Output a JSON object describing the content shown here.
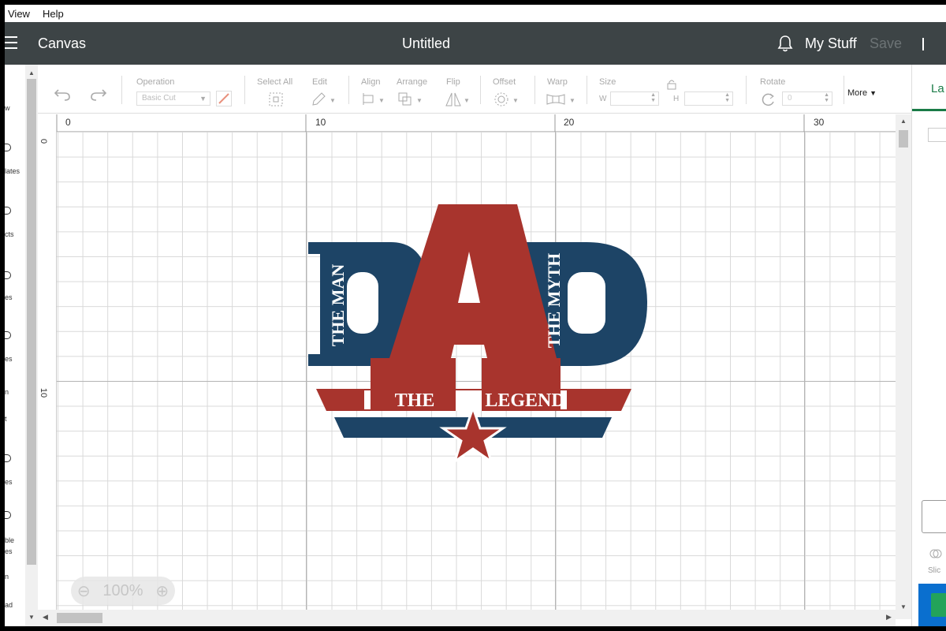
{
  "menu": {
    "items": [
      "View",
      "Help"
    ]
  },
  "header": {
    "app_title": "Canvas",
    "doc_title": "Untitled",
    "my_stuff": "My Stuff",
    "save": "Save"
  },
  "left_nav": {
    "fragments": [
      "w",
      "lates",
      "cts",
      "es",
      "es",
      "n",
      "t",
      "es",
      "ble",
      "es",
      "n",
      "ad"
    ]
  },
  "toolbar": {
    "operation_label": "Operation",
    "operation_value": "Basic Cut",
    "select_all": "Select All",
    "edit": "Edit",
    "align": "Align",
    "arrange": "Arrange",
    "flip": "Flip",
    "offset": "Offset",
    "warp": "Warp",
    "size": "Size",
    "size_w": "W",
    "size_h": "H",
    "rotate": "Rotate",
    "rotate_value": "0",
    "more": "More"
  },
  "right_panel": {
    "tab": "La",
    "slice": "Slic"
  },
  "rulers": {
    "top": [
      "0",
      "10",
      "20",
      "30"
    ],
    "left": [
      "0",
      "10"
    ]
  },
  "zoom": {
    "level": "100%"
  },
  "design": {
    "big_text": "DAD",
    "left_vertical": "THE MAN",
    "right_vertical": "THE MYTH",
    "banner_left": "THE",
    "banner_right": "LEGEND",
    "colors": {
      "blue": "#1d4466",
      "red": "#a8342d"
    }
  }
}
